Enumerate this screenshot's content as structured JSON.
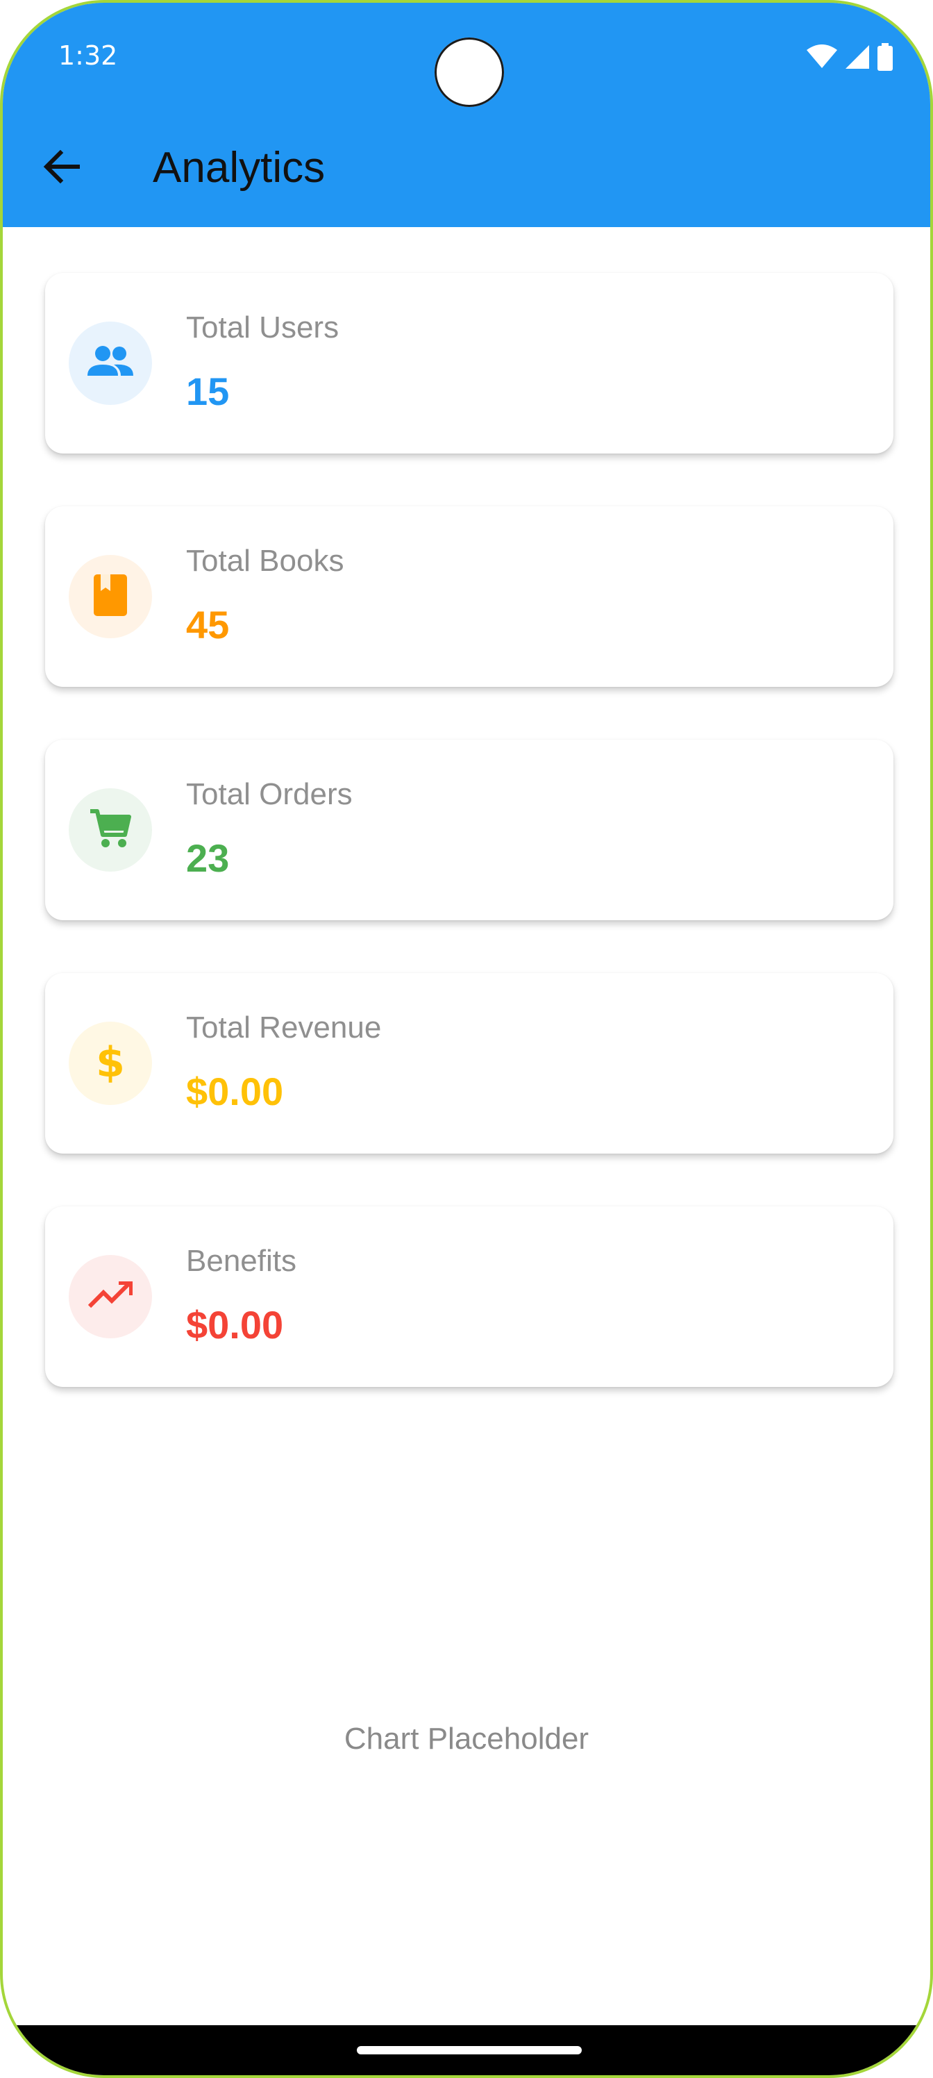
{
  "status_bar": {
    "time": "1:32"
  },
  "app_bar": {
    "title": "Analytics",
    "color": "#2196f3"
  },
  "cards": [
    {
      "label": "Total Users",
      "value": "15",
      "icon": "group-icon",
      "color": "#2196f3",
      "bg": "#e8f3fd"
    },
    {
      "label": "Total Books",
      "value": "45",
      "icon": "book-icon",
      "color": "#ff9800",
      "bg": "#fff3e6"
    },
    {
      "label": "Total Orders",
      "value": "23",
      "icon": "shopping-cart-icon",
      "color": "#4caf50",
      "bg": "#edf6ee"
    },
    {
      "label": "Total Revenue",
      "value": "$0.00",
      "icon": "dollar-icon",
      "color": "#ffc107",
      "bg": "#fff8e4"
    },
    {
      "label": "Benefits",
      "value": "$0.00",
      "icon": "trending-up-icon",
      "color": "#f44336",
      "bg": "#fdeceb"
    }
  ],
  "chart": {
    "placeholder": "Chart Placeholder"
  }
}
